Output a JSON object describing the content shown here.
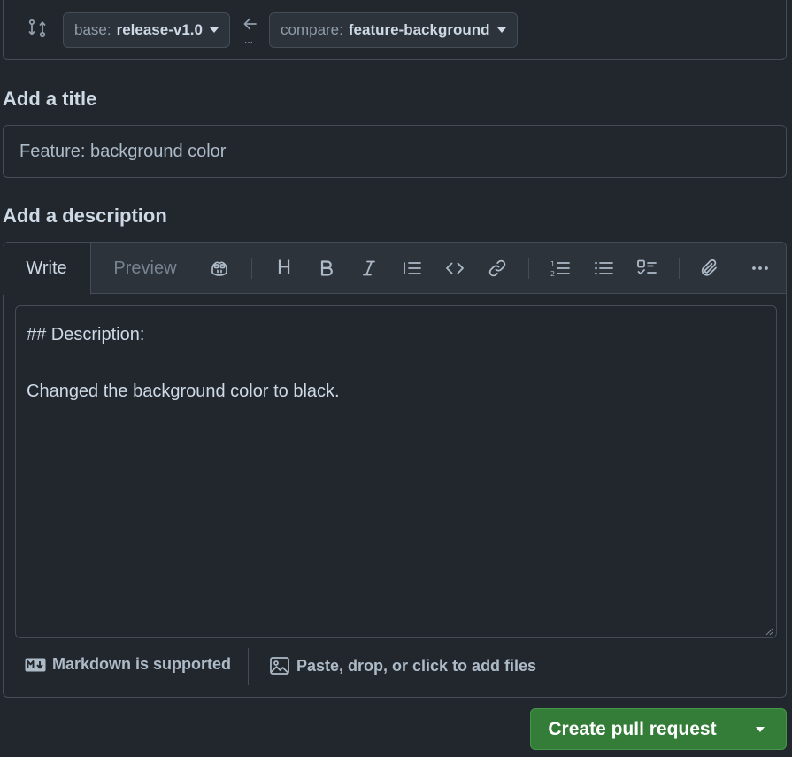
{
  "compare_bar": {
    "base_label": "base:",
    "base_value": "release-v1.0",
    "compare_label": "compare:",
    "compare_value": "feature-background",
    "ellipsis": "..."
  },
  "title_section": {
    "heading": "Add a title",
    "value": "Feature: background color"
  },
  "description_section": {
    "heading": "Add a description",
    "tabs": {
      "write": "Write",
      "preview": "Preview"
    },
    "heading_tool": "H",
    "body_line1": "## Description:",
    "body_line2": "Changed the background color to black.",
    "footer": {
      "markdown_note": "Markdown is supported",
      "files_note": "Paste, drop, or click to add files"
    }
  },
  "actions": {
    "create_label": "Create pull request"
  },
  "colors": {
    "background": "#22272e",
    "border": "#444c56",
    "primary_button": "#347d39"
  }
}
